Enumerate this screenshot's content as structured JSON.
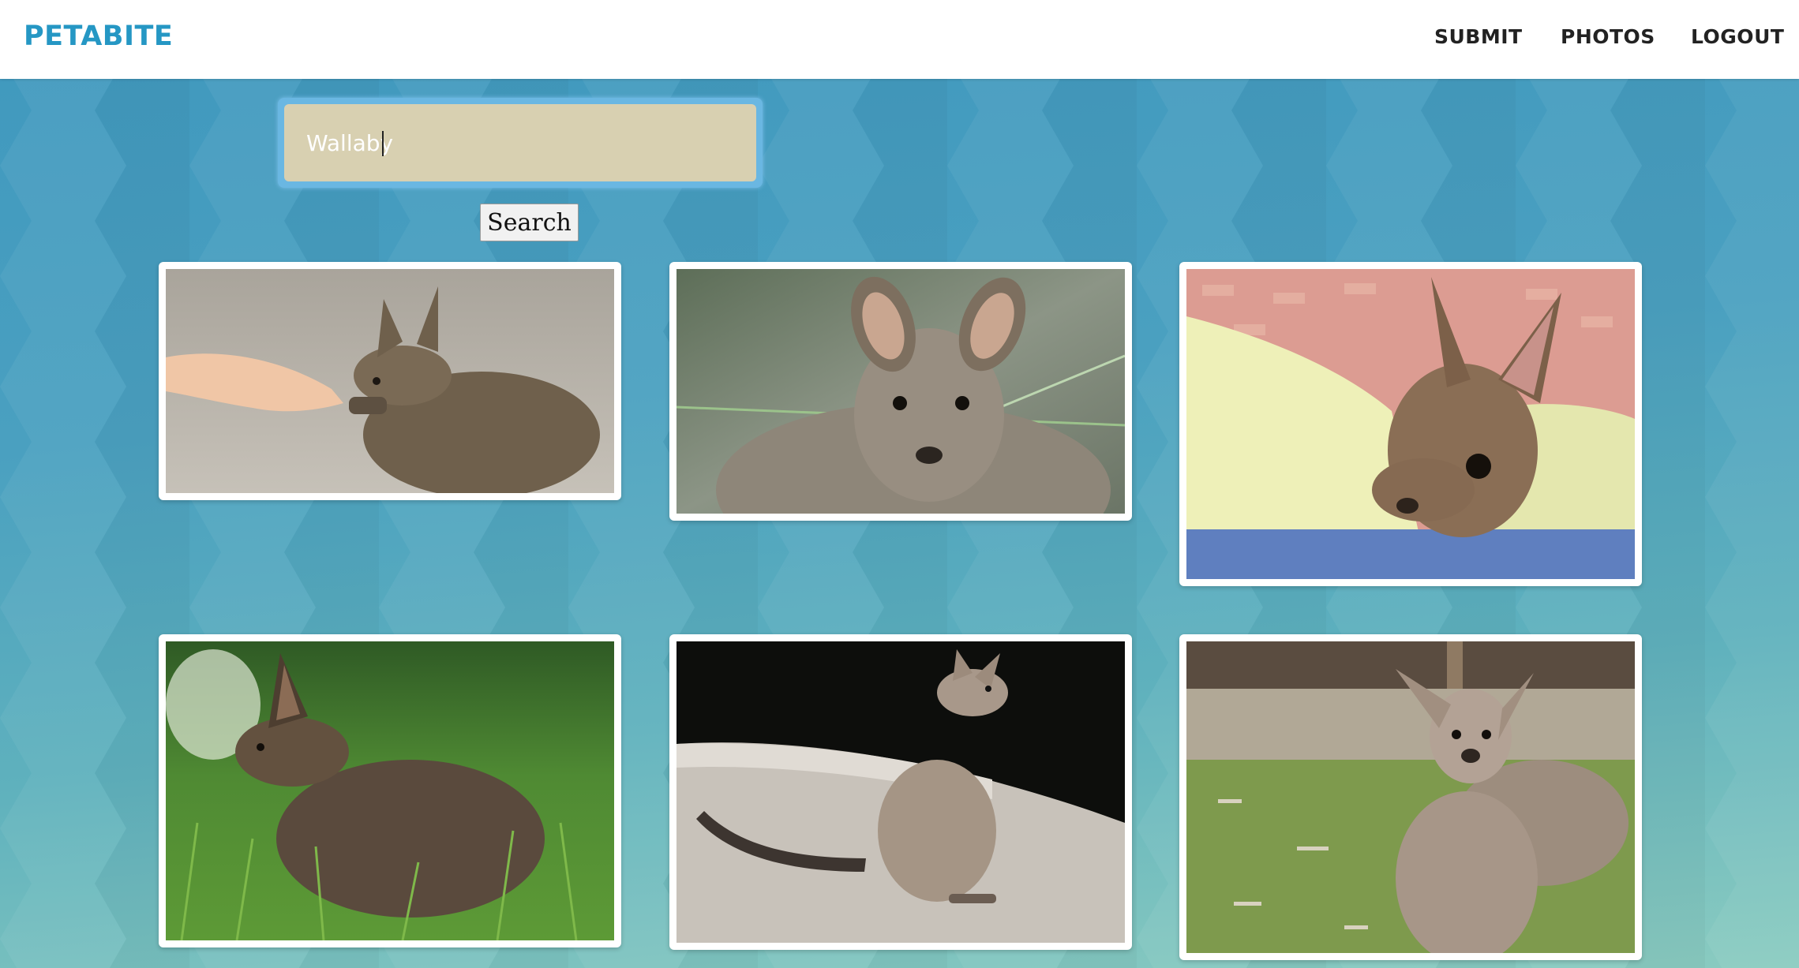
{
  "app": {
    "brand": "PETABITE"
  },
  "nav": {
    "submit": "SUBMIT",
    "photos": "PHOTOS",
    "logout": "LOGOUT"
  },
  "search": {
    "value": "Wallaby",
    "button_label": "Search"
  },
  "colors": {
    "brand": "#2597c4",
    "input_bg": "#d8d0b1",
    "page_bg": "#3f98be"
  }
}
